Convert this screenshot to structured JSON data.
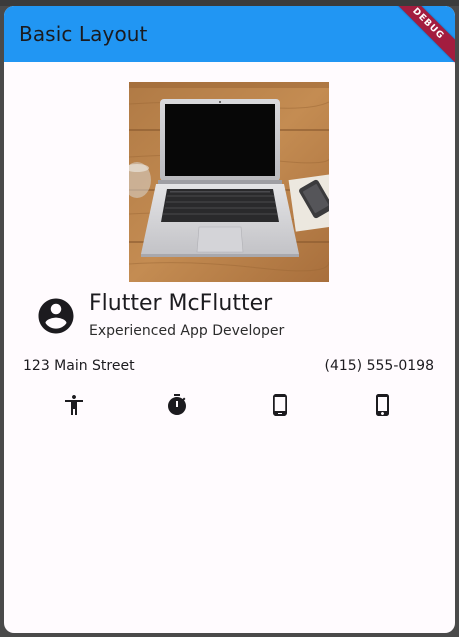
{
  "appbar": {
    "title": "Basic Layout",
    "debug_label": "DEBUG",
    "color": "#2196f3"
  },
  "profile": {
    "name": "Flutter McFlutter",
    "role": "Experienced App Developer"
  },
  "contact": {
    "address": "123 Main Street",
    "phone": "(415) 555-0198"
  },
  "icons": [
    {
      "name": "accessibility-icon"
    },
    {
      "name": "timer-icon"
    },
    {
      "name": "phone-android-icon"
    },
    {
      "name": "phone-iphone-icon"
    }
  ]
}
